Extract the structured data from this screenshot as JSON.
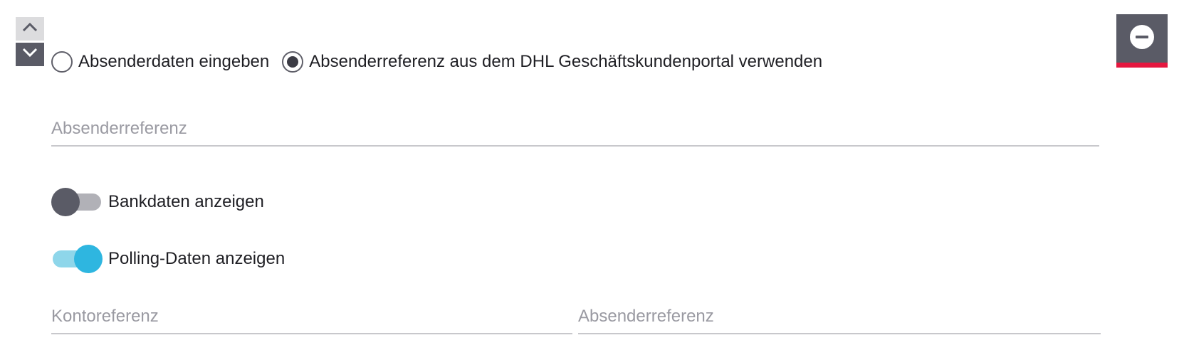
{
  "controls": {
    "move_up_icon": "chevron-up-icon",
    "move_down_icon": "chevron-down-icon",
    "remove_icon": "minus-circle-icon"
  },
  "sender_mode": {
    "options": [
      {
        "label": "Absenderdaten eingeben",
        "selected": false
      },
      {
        "label": "Absenderreferenz aus dem DHL Geschäftskundenportal verwenden",
        "selected": true
      }
    ]
  },
  "sender_reference": {
    "placeholder": "Absenderreferenz",
    "value": ""
  },
  "toggles": {
    "bank_data": {
      "label": "Bankdaten anzeigen",
      "on": false
    },
    "polling_data": {
      "label": "Polling-Daten anzeigen",
      "on": true
    }
  },
  "polling_fields": {
    "account_reference": {
      "placeholder": "Kontoreferenz",
      "value": ""
    },
    "sender_reference": {
      "placeholder": "Absenderreferenz",
      "value": ""
    }
  },
  "colors": {
    "accent_red": "#e5173f",
    "toggle_on": "#2eb6e0",
    "toggle_on_track": "#8ed6ea",
    "toggle_off": "#5a5b66",
    "dark_gray": "#5a5b66"
  }
}
